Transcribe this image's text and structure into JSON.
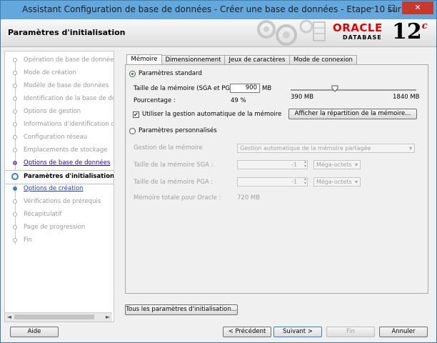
{
  "window": {
    "title": "Assistant Configuration de base de données - Créer une base de données - Etape 10 sur 15"
  },
  "header": {
    "page_title": "Paramètres d'initialisation",
    "brand": "ORACLE",
    "brand_sub": "DATABASE",
    "version": "12",
    "version_suffix": "c"
  },
  "steps": [
    {
      "label": "Opération de base de données",
      "state": "disabled"
    },
    {
      "label": "Mode de création",
      "state": "disabled"
    },
    {
      "label": "Modèle de base de données",
      "state": "disabled"
    },
    {
      "label": "Identification de la base de don",
      "state": "disabled"
    },
    {
      "label": "Options de gestion",
      "state": "disabled"
    },
    {
      "label": "Informations d'identification de",
      "state": "disabled"
    },
    {
      "label": "Configuration réseau",
      "state": "disabled"
    },
    {
      "label": "Emplacements de stockage",
      "state": "disabled"
    },
    {
      "label": "Options de base de données",
      "state": "done"
    },
    {
      "label": "Paramètres d'initialisation",
      "state": "current"
    },
    {
      "label": "Options de création",
      "state": "next"
    },
    {
      "label": "Vérifications de prérequis",
      "state": "disabled"
    },
    {
      "label": "Récapitulatif",
      "state": "disabled"
    },
    {
      "label": "Page de progression",
      "state": "disabled"
    },
    {
      "label": "Fin",
      "state": "disabled"
    }
  ],
  "tabs": [
    {
      "label": "Mémoire",
      "selected": true
    },
    {
      "label": "Dimensionnement",
      "selected": false
    },
    {
      "label": "Jeux de caractères",
      "selected": false
    },
    {
      "label": "Mode de connexion",
      "selected": false
    }
  ],
  "memory": {
    "standard_label": "Paramètres standard",
    "size_label": "Taille de la mémoire (SGA et PGA) :",
    "size_value": "900",
    "size_unit": "MB",
    "percent_label": "Pourcentage :",
    "percent_value": "49 %",
    "slider_min": "390 MB",
    "slider_max": "1840 MB",
    "slider_value_fraction": 0.35,
    "auto_label": "Utiliser la gestion automatique de la mémoire",
    "auto_checked": true,
    "distribution_button": "Afficher la répartition de la mémoire...",
    "custom_label": "Paramètres personnalisés",
    "mgmt_label": "Gestion de la mémoire",
    "mgmt_value": "Gestion automatique de la mémoire partagée",
    "sga_label": "Taille de la mémoire SGA :",
    "sga_value": "-1",
    "sga_unit": "Méga-octets",
    "pga_label": "Taille de la mémoire PGA :",
    "pga_value": "-1",
    "pga_unit": "Méga-octets",
    "total_label": "Mémoire totale pour Oracle :",
    "total_value": "720 MB"
  },
  "all_params_button": "Tous les paramètres d'initialisation...",
  "footer": {
    "help": "Aide",
    "back": "< Précédent",
    "next": "Suivant >",
    "finish": "Fin",
    "cancel": "Annuler"
  },
  "colors": {
    "accent": "#64a7dc",
    "oracle_red": "#e30000",
    "link": "#1a3ecf",
    "visited": "#1c00aa"
  }
}
